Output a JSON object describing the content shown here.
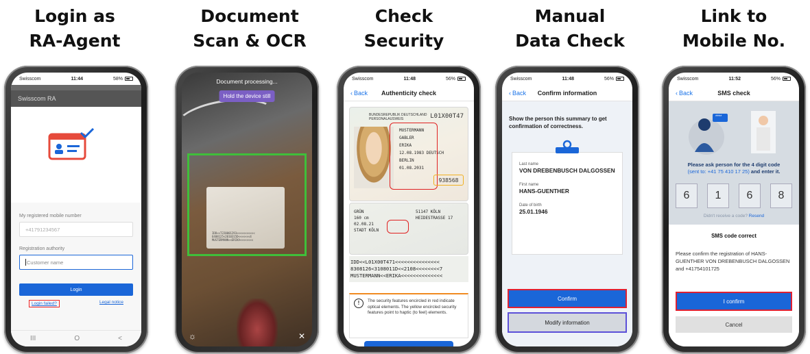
{
  "steps": [
    {
      "title_line1": "Login as",
      "title_line2": "RA-Agent"
    },
    {
      "title_line1": "Document",
      "title_line2": "Scan & OCR"
    },
    {
      "title_line1": "Check",
      "title_line2": "Security"
    },
    {
      "title_line1": "Manual",
      "title_line2": "Data Check"
    },
    {
      "title_line1": "Link to",
      "title_line2": "Mobile No."
    }
  ],
  "screen1": {
    "carrier": "Swisscom",
    "time": "11:44",
    "battery": "58%",
    "app_title": "Swisscom RA",
    "mobile_label": "My registered mobile number",
    "mobile_value": "+41791234567",
    "authority_label": "Registration authority",
    "authority_placeholder": "Customer name",
    "login_button": "Login",
    "login_failed_link": "Login failed?",
    "legal_notice_link": "Legal notice",
    "android_nav": [
      "III",
      "O",
      "<"
    ]
  },
  "screen2": {
    "processing_text": "Document processing...",
    "hold_text": "Hold the device still",
    "card_mrz_lines": [
      "IDD<<T220001293<<<<<<<<<<<",
      "6408125<2010315D<<<<<<<4",
      "MUSTERMANN<<ERIKA<<<<<<<<"
    ],
    "bottom_icons": [
      "sun-icon",
      "close-icon"
    ]
  },
  "screen3": {
    "carrier": "Swisscom",
    "time": "11:48",
    "battery": "56%",
    "back_label": "Back",
    "nav_title": "Authenticity check",
    "doc_header": [
      "BUNDESREPUBLIK DEUTSCHLAND",
      "PERSONALAUSWEIS"
    ],
    "doc_number": "L01X00T47",
    "front_fields": [
      "MUSTERMANN",
      "GABLER",
      "ERIKA",
      "12.08.1983 DEUTSCH",
      "BERLIN",
      "01.08.2031"
    ],
    "can_number": "938568",
    "back_fields": [
      "GRÜN",
      "160 cm",
      "02.08.21",
      "STADT KÖLN"
    ],
    "back_address": [
      "51147 KÖLN",
      "HEIDESTRASSE 17"
    ],
    "mrz_lines": [
      "IDD<<L01X00T471<<<<<<<<<<<<<<<",
      "8308126<3108011D<<2108<<<<<<<<7",
      "MUSTERMANN<<ERIKA<<<<<<<<<<<<<<"
    ],
    "info_text": "The security features encircled in red indicate optical elements. The yellow encircled security features point to haptic (to feel) elements."
  },
  "screen4": {
    "carrier": "Swisscom",
    "time": "11:48",
    "battery": "56%",
    "back_label": "Back",
    "nav_title": "Confirm information",
    "intro": "Show the person this summary to get confirmation of correctness.",
    "last_name_label": "Last name",
    "last_name_value": "VON DREBENBUSCH DALGOSSEN",
    "first_name_label": "First name",
    "first_name_value": "HANS-GUENTHER",
    "dob_label": "Date of birth",
    "dob_value": "25.01.1946",
    "confirm_button": "Confirm",
    "modify_button": "Modify information"
  },
  "screen5": {
    "carrier": "Swisscom",
    "time": "11:52",
    "battery": "56%",
    "back_label": "Back",
    "nav_title": "SMS check",
    "chat_bubble": "****",
    "prompt": "Please ask person for the 4 digit code",
    "prompt_sub": "(sent to: +41 75 410 17 25)",
    "prompt_end": "and enter it.",
    "digits": [
      "6",
      "1",
      "6",
      "8"
    ],
    "resend_question": "Didn't receive a code?",
    "resend_link": "Resend",
    "dialog_title": "SMS code correct",
    "dialog_text": "Please confirm the registration of HANS-GUENTHER VON DREBENBUSCH DALGOSSEN and +41754101725",
    "confirm_button": "I confirm",
    "cancel_button": "Cancel"
  },
  "colors": {
    "primary_blue": "#1a66d8",
    "highlight_red": "#e02030",
    "highlight_purple": "#5b4fd8",
    "scan_green": "#3fbf3a",
    "hint_purple": "#7b5fc4"
  }
}
